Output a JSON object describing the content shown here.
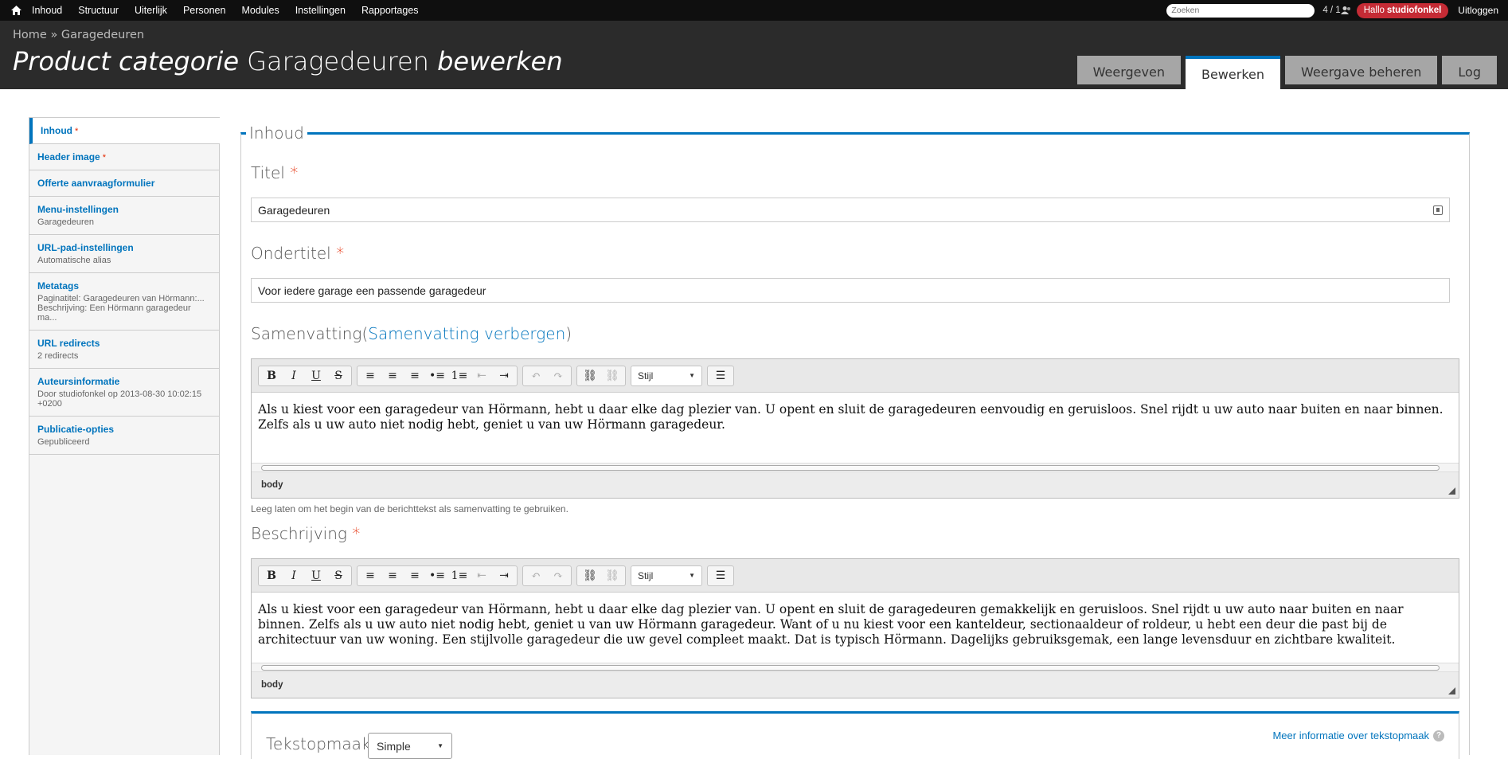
{
  "toolbar": {
    "menu": [
      "Inhoud",
      "Structuur",
      "Uiterlijk",
      "Personen",
      "Modules",
      "Instellingen",
      "Rapportages"
    ],
    "search_placeholder": "Zoeken",
    "counter": "4 / 1",
    "hello": "Hallo",
    "user": "studiofonkel",
    "logout": "Uitloggen"
  },
  "header": {
    "breadcrumb": [
      "Home",
      "»",
      "Garagedeuren"
    ],
    "title_prefix": "Product categorie",
    "title_name": "Garagedeuren",
    "title_suffix": "bewerken",
    "tabs": [
      "Weergeven",
      "Bewerken",
      "Weergave beheren",
      "Log"
    ],
    "active_tab": "Bewerken"
  },
  "sidebar": {
    "items": [
      {
        "title": "Inhoud",
        "required": "*",
        "summary": ""
      },
      {
        "title": "Header image",
        "required": "*",
        "summary": ""
      },
      {
        "title": "Offerte aanvraagformulier",
        "required": "",
        "summary": ""
      },
      {
        "title": "Menu-instellingen",
        "required": "",
        "summary": "Garagedeuren"
      },
      {
        "title": "URL-pad-instellingen",
        "required": "",
        "summary": "Automatische alias"
      },
      {
        "title": "Metatags",
        "required": "",
        "summary": "Paginatitel: Garagedeuren van Hörmann:...",
        "summary2": "Beschrijving: Een Hörmann garagedeur ma..."
      },
      {
        "title": "URL redirects",
        "required": "",
        "summary": "2 redirects"
      },
      {
        "title": "Auteursinformatie",
        "required": "",
        "summary": "Door studiofonkel op 2013-08-30 10:02:15 +0200"
      },
      {
        "title": "Publicatie-opties",
        "required": "",
        "summary": "Gepubliceerd"
      }
    ]
  },
  "main": {
    "legend": "Inhoud",
    "title_label": "Titel",
    "required_mark": "*",
    "title_value": "Garagedeuren",
    "subtitle_label": "Ondertitel",
    "subtitle_value": "Voor iedere garage een passende garagedeur",
    "summary_label": "Samenvatting",
    "summary_toggle": "Samenvatting verbergen",
    "summary_text": "Als u kiest voor een garagedeur van Hörmann, hebt u daar elke dag plezier van. U opent en sluit de garagedeuren eenvoudig en geruisloos. Snel rijdt u uw auto naar buiten en naar binnen. Zelfs als u uw auto niet nodig hebt, geniet u van uw Hörmann garagedeur.",
    "summary_help": "Leeg laten om het begin van de berichttekst als samenvatting te gebruiken.",
    "description_label": "Beschrijving",
    "description_text": "Als u kiest voor een garagedeur van Hörmann, hebt u daar elke dag plezier van. U opent en sluit de garagedeuren gemakkelijk en geruisloos. Snel rijdt u uw auto naar buiten en naar binnen. Zelfs als u uw auto niet nodig hebt, geniet u van uw Hörmann garagedeur. Want of u nu kiest voor een kanteldeur, sectionaaldeur of roldeur, u hebt een deur die past bij de architectuur van uw woning. Een stijlvolle garagedeur die uw gevel compleet maakt. Dat is typisch Hörmann. Dagelijks gebruiksgemak, een lange levensduur en zichtbare kwaliteit.",
    "editor_style": "Stijl",
    "editor_path": "body",
    "format_label": "Tekstopmaak",
    "format_value": "Simple",
    "format_link": "Meer informatie over tekstopmaak"
  },
  "colors": {
    "accent": "#0074bd",
    "required": "#e32700",
    "hello_badge": "#c52b35",
    "toolbar_bg": "#0f0f0f",
    "header_bg": "#2b2b2b"
  }
}
